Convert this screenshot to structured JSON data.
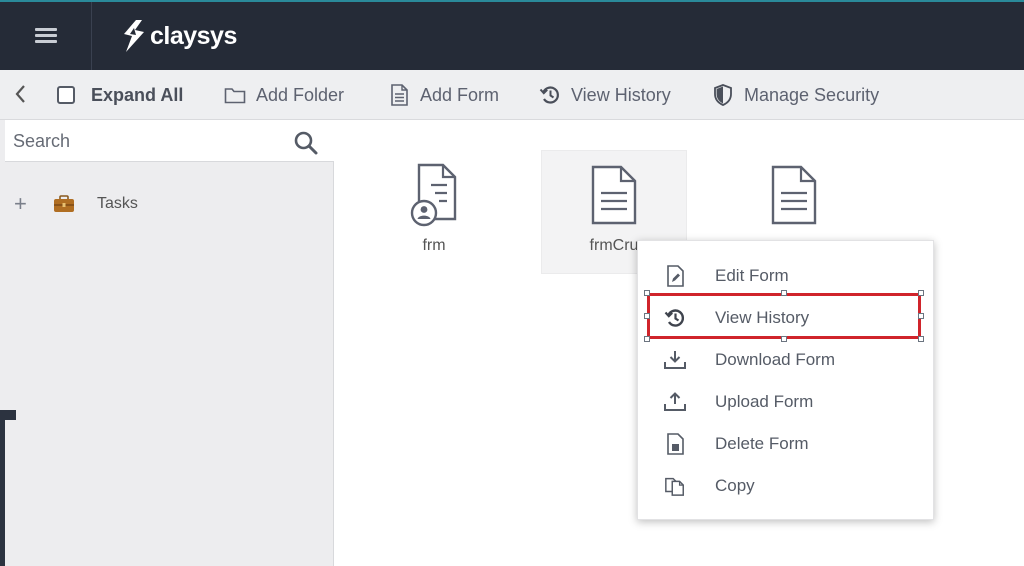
{
  "header": {
    "logo_text": "claysys",
    "menu_icon": "hamburger-icon"
  },
  "toolbar": {
    "expand_all": "Expand All",
    "add_folder": "Add Folder",
    "add_form": "Add Form",
    "view_history": "View History",
    "manage_security": "Manage Security"
  },
  "sidebar": {
    "search_placeholder": "Search",
    "tree": [
      {
        "label": "Tasks",
        "expander": "+"
      }
    ]
  },
  "forms": [
    {
      "label": "frm"
    },
    {
      "label": "frmCru"
    },
    {
      "label": ""
    }
  ],
  "context_menu": {
    "items": [
      {
        "label": "Edit Form",
        "icon": "edit-form-icon"
      },
      {
        "label": "View History",
        "icon": "history-icon"
      },
      {
        "label": "Download Form",
        "icon": "download-icon"
      },
      {
        "label": "Upload Form",
        "icon": "upload-icon"
      },
      {
        "label": "Delete Form",
        "icon": "delete-form-icon"
      },
      {
        "label": "Copy",
        "icon": "copy-icon"
      }
    ],
    "highlighted": "View History"
  },
  "colors": {
    "header_bg": "#252b37",
    "toolbar_bg": "#eeeff1",
    "sidebar_bg": "#ededef",
    "highlight_red": "#d0242b"
  }
}
